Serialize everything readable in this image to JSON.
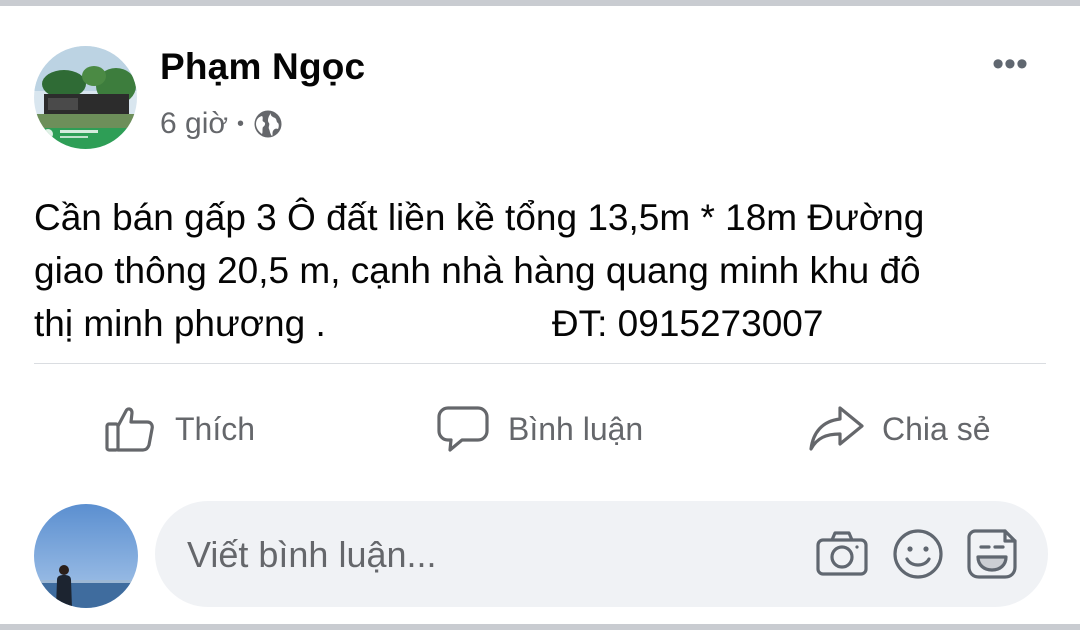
{
  "post": {
    "author": "Phạm Ngọc",
    "time": "6 giờ",
    "separator": "•",
    "privacy_icon": "globe-icon",
    "more_icon": "•••",
    "text": "Cần bán gấp 3 Ô đất liền kề tổng 13,5m * 18m Đường\ngiao thông 20,5 m, cạnh nhà hàng quang minh khu đô\nthị minh phương .                      ĐT: 0915273007"
  },
  "actions": {
    "like_label": "Thích",
    "comment_label": "Bình luận",
    "share_label": "Chia sẻ"
  },
  "composer": {
    "placeholder": "Viết bình luận...",
    "icons": [
      "camera-icon",
      "emoji-icon",
      "sticker-icon"
    ]
  },
  "colors": {
    "text_primary": "#050505",
    "text_secondary": "#65676b",
    "composer_bg": "#f0f2f5",
    "divider": "#dadde1"
  }
}
